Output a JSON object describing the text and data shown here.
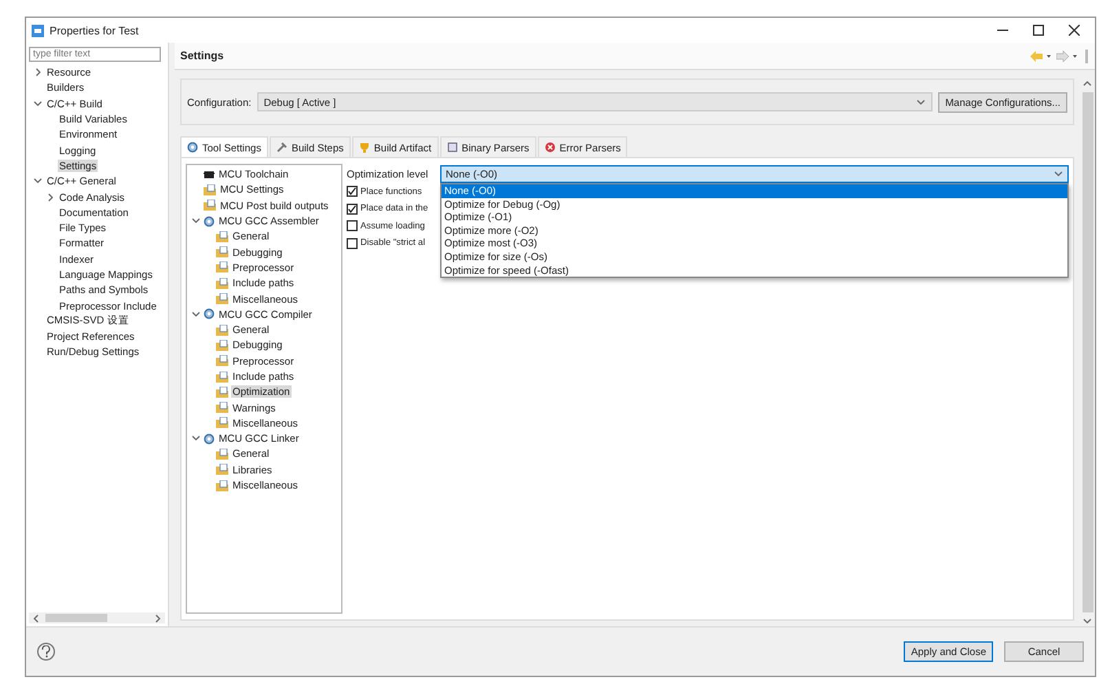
{
  "window": {
    "title": "Properties for Test"
  },
  "filter": {
    "placeholder": "type filter text"
  },
  "sidebar": {
    "items": [
      {
        "label": "Resource",
        "expanded": false,
        "selected": false
      },
      {
        "label": "Builders",
        "selected": false
      },
      {
        "label": "C/C++ Build",
        "expanded": true,
        "selected": false,
        "children": [
          {
            "label": "Build Variables",
            "selected": false
          },
          {
            "label": "Environment",
            "selected": false
          },
          {
            "label": "Logging",
            "selected": false
          },
          {
            "label": "Settings",
            "selected": true
          }
        ]
      },
      {
        "label": "C/C++ General",
        "expanded": true,
        "selected": false,
        "children": [
          {
            "label": "Code Analysis",
            "expanded": false,
            "selected": false
          },
          {
            "label": "Documentation",
            "selected": false
          },
          {
            "label": "File Types",
            "selected": false
          },
          {
            "label": "Formatter",
            "selected": false
          },
          {
            "label": "Indexer",
            "selected": false
          },
          {
            "label": "Language Mappings",
            "selected": false
          },
          {
            "label": "Paths and Symbols",
            "selected": false
          },
          {
            "label": "Preprocessor Include",
            "selected": false
          }
        ]
      },
      {
        "label": "CMSIS-SVD 设置",
        "selected": false
      },
      {
        "label": "Project References",
        "selected": false
      },
      {
        "label": "Run/Debug Settings",
        "selected": false
      }
    ]
  },
  "header": {
    "title": "Settings"
  },
  "configuration": {
    "label": "Configuration:",
    "value": "Debug  [ Active ]",
    "button": "Manage Configurations..."
  },
  "tabs": [
    {
      "label": "Tool Settings",
      "kind": "tool",
      "selected": true
    },
    {
      "label": "Build Steps",
      "kind": "steps",
      "selected": false
    },
    {
      "label": "Build Artifact",
      "kind": "artifact",
      "selected": false
    },
    {
      "label": "Binary Parsers",
      "kind": "parsers",
      "selected": false
    },
    {
      "label": "Error Parsers",
      "kind": "error",
      "selected": false
    }
  ],
  "tool_tree": [
    {
      "label": "MCU Toolchain",
      "kind": "toolchain",
      "selected": false
    },
    {
      "label": "MCU Settings",
      "kind": "page",
      "selected": false
    },
    {
      "label": "MCU Post build outputs",
      "kind": "page",
      "selected": false
    },
    {
      "label": "MCU GCC Assembler",
      "kind": "tool",
      "expanded": true,
      "selected": false,
      "children": [
        {
          "label": "General",
          "kind": "page",
          "selected": false
        },
        {
          "label": "Debugging",
          "kind": "page",
          "selected": false
        },
        {
          "label": "Preprocessor",
          "kind": "page",
          "selected": false
        },
        {
          "label": "Include paths",
          "kind": "page",
          "selected": false
        },
        {
          "label": "Miscellaneous",
          "kind": "page",
          "selected": false
        }
      ]
    },
    {
      "label": "MCU GCC Compiler",
      "kind": "tool",
      "expanded": true,
      "selected": false,
      "children": [
        {
          "label": "General",
          "kind": "page",
          "selected": false
        },
        {
          "label": "Debugging",
          "kind": "page",
          "selected": false
        },
        {
          "label": "Preprocessor",
          "kind": "page",
          "selected": false
        },
        {
          "label": "Include paths",
          "kind": "page",
          "selected": false
        },
        {
          "label": "Optimization",
          "kind": "page",
          "selected": true
        },
        {
          "label": "Warnings",
          "kind": "page",
          "selected": false
        },
        {
          "label": "Miscellaneous",
          "kind": "page",
          "selected": false
        }
      ]
    },
    {
      "label": "MCU GCC Linker",
      "kind": "tool",
      "expanded": true,
      "selected": false,
      "children": [
        {
          "label": "General",
          "kind": "page",
          "selected": false
        },
        {
          "label": "Libraries",
          "kind": "page",
          "selected": false
        },
        {
          "label": "Miscellaneous",
          "kind": "page",
          "selected": false
        }
      ]
    }
  ],
  "optimization": {
    "label": "Optimization level",
    "value": "None (-O0)",
    "options": [
      {
        "label": "None (-O0)",
        "selected": true
      },
      {
        "label": "Optimize for Debug (-Og)",
        "selected": false
      },
      {
        "label": "Optimize (-O1)",
        "selected": false
      },
      {
        "label": "Optimize more (-O2)",
        "selected": false
      },
      {
        "label": "Optimize most (-O3)",
        "selected": false
      },
      {
        "label": "Optimize for size (-Os)",
        "selected": false
      },
      {
        "label": "Optimize for speed (-Ofast)",
        "selected": false
      }
    ]
  },
  "checkboxes": [
    {
      "label": "Place functions",
      "checked": true
    },
    {
      "label": "Place data in the",
      "checked": true
    },
    {
      "label": "Assume loading",
      "checked": false
    },
    {
      "label": "Disable \"strict al",
      "checked": false
    }
  ],
  "buttons": [
    {
      "label": "Apply and Close",
      "default": true
    },
    {
      "label": "Cancel",
      "default": false
    }
  ]
}
